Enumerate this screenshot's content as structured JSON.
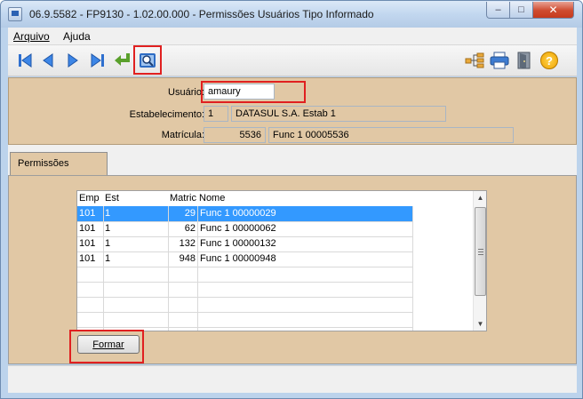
{
  "window": {
    "title": "06.9.5582 - FP9130 - 1.02.00.000 - Permissões Usuários Tipo Informado",
    "minimize_glyph": "–",
    "maximize_glyph": "□",
    "close_glyph": "✕"
  },
  "menu": {
    "items": [
      {
        "label": "Arquivo"
      },
      {
        "label": "Ajuda"
      }
    ]
  },
  "toolbar": {
    "icons": [
      "first-record-icon",
      "previous-record-icon",
      "next-record-icon",
      "last-record-icon",
      "go-to-icon",
      "search-icon",
      "tree-icon",
      "print-icon",
      "exit-icon",
      "help-icon"
    ],
    "help_glyph": "?"
  },
  "header": {
    "usuario_label": "Usuário:",
    "usuario_value": "amaury",
    "estabelecimento_label": "Estabelecimento:",
    "estabelecimento_code": "1",
    "estabelecimento_name": "DATASUL S.A. Estab 1",
    "matricula_label": "Matrícula:",
    "matricula_code": "5536",
    "matricula_name": "Func 1  00005536"
  },
  "tabs": [
    {
      "label": "Permissões"
    }
  ],
  "grid": {
    "columns": [
      "Emp",
      "Est",
      "Matric",
      "Nome"
    ],
    "rows": [
      {
        "emp": "101",
        "est": "1",
        "matric": "29",
        "nome": "Func 1  00000029"
      },
      {
        "emp": "101",
        "est": "1",
        "matric": "62",
        "nome": "Func 1  00000062"
      },
      {
        "emp": "101",
        "est": "1",
        "matric": "132",
        "nome": "Func 1  00000132"
      },
      {
        "emp": "101",
        "est": "1",
        "matric": "948",
        "nome": "Func 1  00000948"
      }
    ],
    "scroll_up_glyph": "▲",
    "scroll_down_glyph": "▼"
  },
  "actions": {
    "formar_label": "Formar"
  },
  "colors": {
    "panel": "#e1c8a5",
    "highlight": "#e02020",
    "selection": "#3399ff"
  }
}
